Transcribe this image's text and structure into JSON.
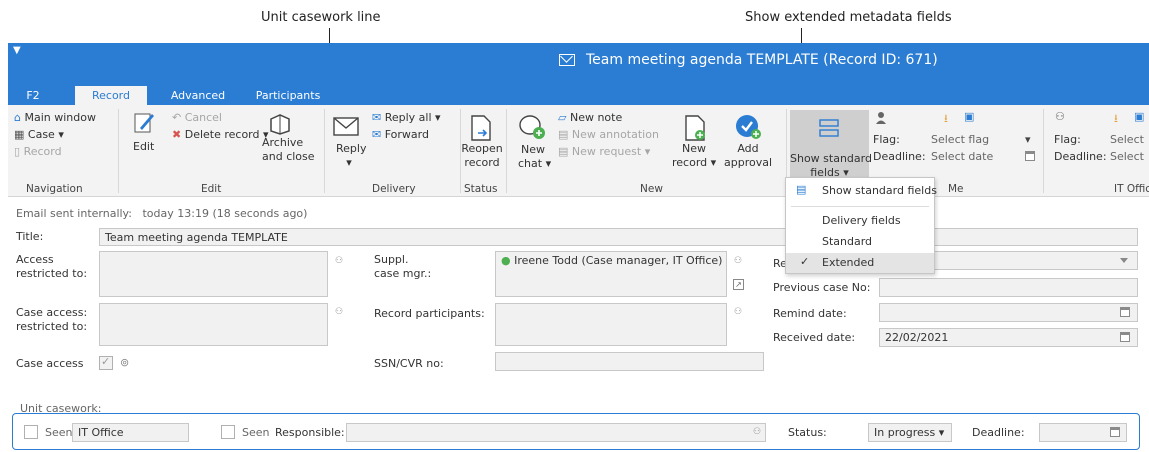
{
  "annotations": {
    "unit_casework_line": "Unit casework line",
    "show_extended_fields": "Show extended metadata fields"
  },
  "window": {
    "title": "Team meeting agenda TEMPLATE (Record ID: 671)",
    "accent": "#2b7cd3",
    "tabs": [
      "F2",
      "Record",
      "Advanced",
      "Participants"
    ],
    "active_tab": "Record"
  },
  "ribbon": {
    "navigation": {
      "main_window": "Main window",
      "case": "Case",
      "record": "Record",
      "group": "Navigation"
    },
    "edit": {
      "edit": "Edit",
      "cancel": "Cancel",
      "delete_record": "Delete record",
      "archive_close_1": "Archive",
      "archive_close_2": "and close",
      "group": "Edit"
    },
    "delivery": {
      "reply": "Reply",
      "reply_all": "Reply all",
      "forward": "Forward",
      "group": "Delivery"
    },
    "status": {
      "reopen_1": "Reopen",
      "reopen_2": "record",
      "group": "Status"
    },
    "new": {
      "new_chat_1": "New",
      "new_chat_2": "chat",
      "new_note": "New note",
      "new_annotation": "New annotation",
      "new_request": "New request",
      "new_record_1": "New",
      "new_record_2": "record",
      "add_approval_1": "Add",
      "add_approval_2": "approval",
      "group": "New"
    },
    "show_standard_fields": {
      "line1": "Show standard",
      "line2": "fields"
    },
    "me": {
      "flag_label": "Flag:",
      "flag_value": "Select flag",
      "deadline_label": "Deadline:",
      "deadline_value": "Select date",
      "group": "Me"
    },
    "it_office": {
      "flag_label": "Flag:",
      "flag_value": "Select",
      "deadline_label": "Deadline:",
      "deadline_value": "Select",
      "group": "IT Office"
    }
  },
  "dropdown_menu": {
    "items": [
      "Show standard fields",
      "Delivery fields",
      "Standard",
      "Extended"
    ],
    "selected": "Extended"
  },
  "form": {
    "email_sent": "Email sent internally:",
    "email_time": "today 13:19 (18 seconds ago)",
    "title_label": "Title:",
    "title_value": "Team meeting agenda TEMPLATE",
    "access_label_1": "Access",
    "access_label_2": "restricted to:",
    "case_access_label_1": "Case access:",
    "case_access_label_2": "restricted to:",
    "case_access_check_label": "Case access",
    "suppl_label_1": "Suppl.",
    "suppl_label_2": "case mgr.:",
    "suppl_value": "Ireene Todd (Case manager, IT Office)",
    "record_participants": "Record participants:",
    "ssn_label": "SSN/CVR no:",
    "rec_label": "Rec",
    "previous_case": "Previous case No:",
    "remind_date": "Remind date:",
    "received_date": "Received date:",
    "received_value": "22/02/2021"
  },
  "casework": {
    "section_label": "Unit casework:",
    "seen_1": "Seen",
    "unit": "IT Office",
    "seen_2": "Seen",
    "responsible_label": "Responsible:",
    "status_label": "Status:",
    "status_value": "In progress",
    "deadline_label": "Deadline:"
  }
}
